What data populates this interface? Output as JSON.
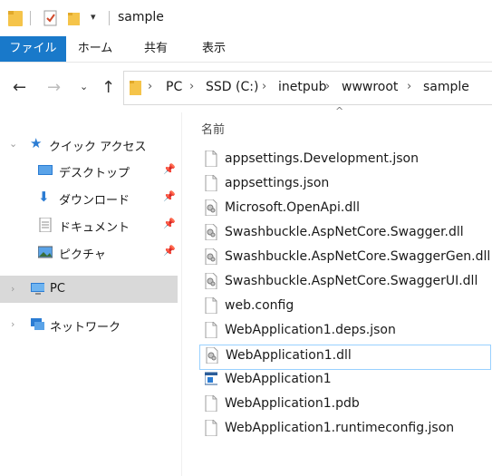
{
  "window": {
    "title": "sample"
  },
  "ribbon": {
    "tabs": [
      "ファイル",
      "ホーム",
      "共有",
      "表示"
    ]
  },
  "address": {
    "crumbs": [
      "PC",
      "SSD (C:)",
      "inetpub",
      "wwwroot",
      "sample"
    ]
  },
  "nav": {
    "quick_access": "クイック アクセス",
    "items": [
      "デスクトップ",
      "ダウンロード",
      "ドキュメント",
      "ピクチャ"
    ],
    "pc": "PC",
    "network": "ネットワーク"
  },
  "files": {
    "column_name": "名前",
    "items": [
      {
        "name": "appsettings.Development.json",
        "icon": "blank-file-icon"
      },
      {
        "name": "appsettings.json",
        "icon": "blank-file-icon"
      },
      {
        "name": "Microsoft.OpenApi.dll",
        "icon": "dll-file-icon"
      },
      {
        "name": "Swashbuckle.AspNetCore.Swagger.dll",
        "icon": "dll-file-icon"
      },
      {
        "name": "Swashbuckle.AspNetCore.SwaggerGen.dll",
        "icon": "dll-file-icon"
      },
      {
        "name": "Swashbuckle.AspNetCore.SwaggerUI.dll",
        "icon": "dll-file-icon"
      },
      {
        "name": "web.config",
        "icon": "blank-file-icon"
      },
      {
        "name": "WebApplication1.deps.json",
        "icon": "blank-file-icon"
      },
      {
        "name": "WebApplication1.dll",
        "icon": "dll-file-icon"
      },
      {
        "name": "WebApplication1",
        "icon": "exe-file-icon"
      },
      {
        "name": "WebApplication1.pdb",
        "icon": "blank-file-icon"
      },
      {
        "name": "WebApplication1.runtimeconfig.json",
        "icon": "blank-file-icon"
      }
    ]
  },
  "colors": {
    "accent": "#1979ca",
    "folder": "#f5c44a",
    "selection": "#d9d9d9",
    "focus": "#99d1ff"
  }
}
